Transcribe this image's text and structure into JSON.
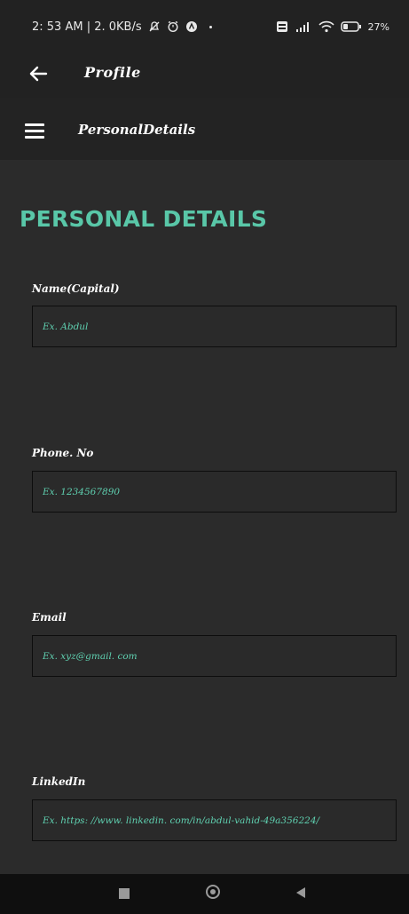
{
  "status": {
    "left_text": "2: 53 AM | 2. 0KB/s",
    "battery": "27%"
  },
  "appbar": {
    "title": "Profile"
  },
  "subbar": {
    "title": "PersonalDetails"
  },
  "heading": "PERSONAL DETAILS",
  "fields": [
    {
      "label": "Name(Capital)",
      "placeholder": "Ex. Abdul"
    },
    {
      "label": "Phone. No",
      "placeholder": "Ex. 1234567890"
    },
    {
      "label": "Email",
      "placeholder": "Ex. xyz@gmail. com"
    },
    {
      "label": "LinkedIn",
      "placeholder": "Ex. https: //www. linkedin. com/in/abdul-vahid-49a356224/"
    }
  ],
  "colors": {
    "accent": "#59c7a8",
    "background": "#2b2b2b",
    "bar": "#222222"
  },
  "icons": [
    "back-arrow-icon",
    "hamburger-menu-icon",
    "alarm-icon",
    "signal-icon",
    "wifi-icon",
    "battery-icon"
  ]
}
